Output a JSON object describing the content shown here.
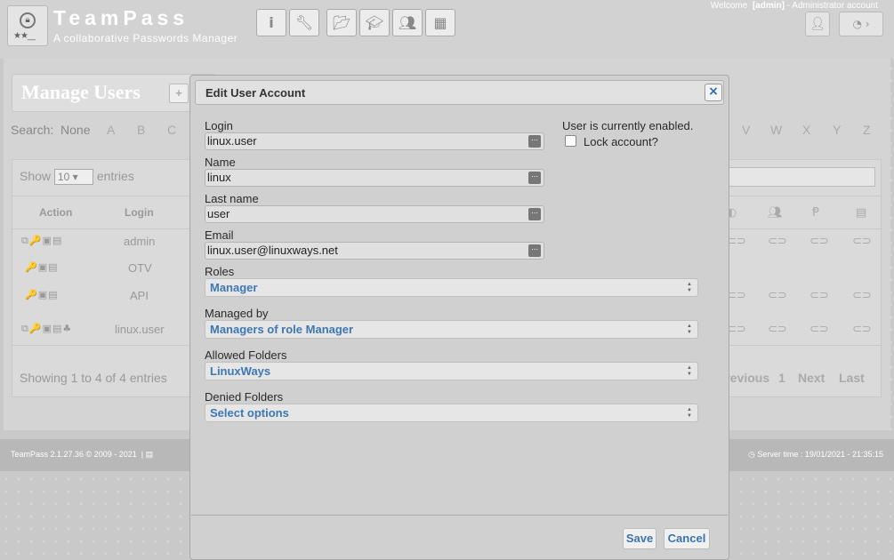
{
  "header": {
    "app_title": "TeamPass",
    "app_subtitle": "A collaborative Passwords Manager",
    "welcome_prefix": "Welcome",
    "welcome_user": "[admin]",
    "welcome_suffix": "- Administrator account",
    "nav_icons": [
      "info-icon",
      "wrench-icon",
      "folder-open-icon",
      "graduation-cap-icon",
      "users-icon",
      "cubes-icon"
    ]
  },
  "page": {
    "title": "Manage Users",
    "search_label": "Search:",
    "search_none": "None",
    "letters_left": [
      "A",
      "B",
      "C"
    ],
    "letters_right": [
      "V",
      "W",
      "X",
      "Y",
      "Z"
    ],
    "show_label": "Show",
    "show_value": "10",
    "entries_label": "entries",
    "columns": [
      "Action",
      "Login"
    ],
    "rows": [
      {
        "login": "admin",
        "actions": "⧉🔑▣▤"
      },
      {
        "login": "OTV",
        "actions": "🔑▣▤"
      },
      {
        "login": "API",
        "actions": "🔑▣▤"
      },
      {
        "login": "linux.user",
        "actions": "⧉🔑▣▤♣"
      }
    ],
    "showing": "Showing 1 to 4 of 4 entries",
    "pager": {
      "previous": "Previous",
      "page": "1",
      "next": "Next",
      "last": "Last"
    }
  },
  "footer": {
    "left": "TeamPass 2.1.27.36 © 2009 - 2021",
    "right": "Server time : 19/01/2021 - 21:35:15"
  },
  "modal": {
    "title": "Edit User Account",
    "login_label": "Login",
    "login_value": "linux.user",
    "name_label": "Name",
    "name_value": "linux",
    "lastname_label": "Last name",
    "lastname_value": "user",
    "email_label": "Email",
    "email_value": "linux.user@linuxways.net",
    "status_text": "User is currently enabled.",
    "lock_label": "Lock account?",
    "lock_checked": false,
    "roles_label": "Roles",
    "roles_value": "Manager",
    "managed_label": "Managed by",
    "managed_value": "Managers of role Manager",
    "allowed_label": "Allowed Folders",
    "allowed_value": "LinuxWays",
    "denied_label": "Denied Folders",
    "denied_value": "Select options",
    "save_label": "Save",
    "cancel_label": "Cancel"
  },
  "colors": {
    "accent": "#3d77b4",
    "overlay": "#c9c9c9",
    "dialog": "#d0d0d0"
  }
}
